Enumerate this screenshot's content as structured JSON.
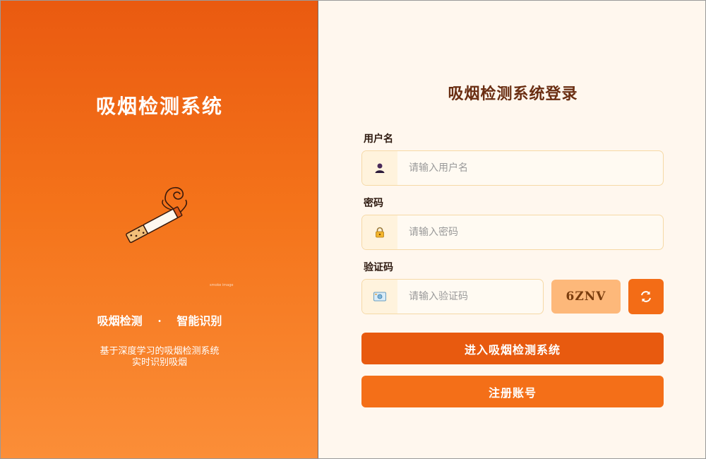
{
  "left": {
    "title": "吸烟检测系统",
    "illustration_caption": "smoke image",
    "tagline_left": "吸烟检测",
    "tagline_sep": "·",
    "tagline_right": "智能识别",
    "desc_line1": "基于深度学习的吸烟检测系统",
    "desc_line2": "实时识别吸烟"
  },
  "form": {
    "title": "吸烟检测系统登录",
    "username_label": "用户名",
    "username_placeholder": "请输入用户名",
    "username_value": "",
    "password_label": "密码",
    "password_placeholder": "请输入密码",
    "password_value": "",
    "captcha_label": "验证码",
    "captcha_placeholder": "请输入验证码",
    "captcha_value": "",
    "captcha_code": "6ZNV",
    "login_button": "进入吸烟检测系统",
    "register_button": "注册账号"
  },
  "icons": {
    "username": "user-icon",
    "password": "lock-icon",
    "captcha": "id-card-icon",
    "refresh": "refresh-icon"
  },
  "colors": {
    "left_gradient_top": "#ea5a10",
    "left_gradient_bottom": "#fb8e38",
    "form_background": "#fff7ee",
    "title_color": "#6a2e12",
    "login_button": "#e85a0f",
    "register_button": "#f46f18",
    "captcha_bg": "#fdb87a"
  }
}
